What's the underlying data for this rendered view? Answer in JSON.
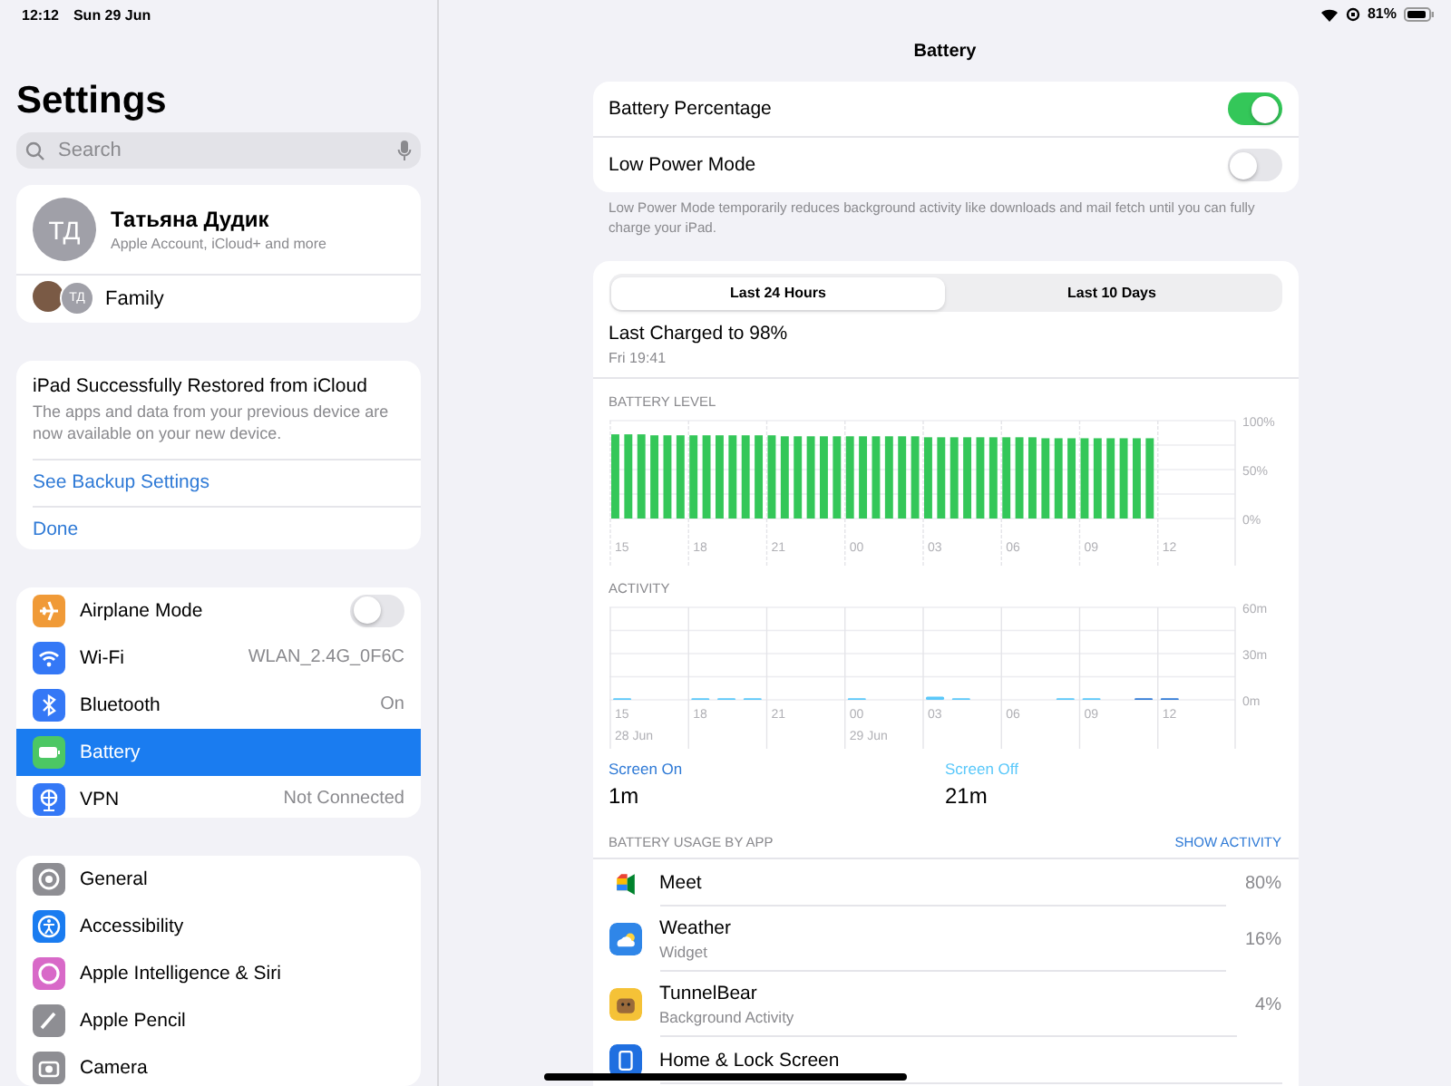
{
  "status_bar": {
    "time": "12:12",
    "date": "Sun 29 Jun",
    "battery": "81%"
  },
  "sidebar": {
    "title": "Settings",
    "search": {
      "placeholder": "Search"
    },
    "profile": {
      "initials": "ТД",
      "name": "Татьяна Дудик",
      "subtitle": "Apple Account, iCloud+ and more",
      "family_initials": "ТД",
      "family_label": "Family"
    },
    "notice": {
      "title": "iPad Successfully Restored from iCloud",
      "text": "The apps and data from your previous device are now available on your new device.",
      "links": [
        "See Backup Settings",
        "Done"
      ]
    },
    "groups": [
      {
        "items": [
          {
            "label": "Airplane Mode",
            "kind": "toggle",
            "on": false,
            "selected": false,
            "color": "#f09a37"
          },
          {
            "label": "Wi-Fi",
            "kind": "value",
            "value": "WLAN_2.4G_0F6C",
            "selected": false,
            "color": "#3478f6"
          },
          {
            "label": "Bluetooth",
            "kind": "value",
            "value": "On",
            "selected": false,
            "color": "#3478f6"
          },
          {
            "label": "Battery",
            "kind": "plain",
            "selected": true,
            "color": "#4cc764"
          },
          {
            "label": "VPN",
            "kind": "value",
            "value": "Not Connected",
            "selected": false,
            "color": "#3478f6"
          }
        ]
      },
      {
        "items": [
          {
            "label": "General",
            "kind": "plain",
            "selected": false,
            "color": "#8e8e93"
          },
          {
            "label": "Accessibility",
            "kind": "plain",
            "selected": false,
            "color": "#1a7cf0"
          },
          {
            "label": "Apple Intelligence & Siri",
            "kind": "plain",
            "selected": false,
            "color": "#d869c8"
          },
          {
            "label": "Apple Pencil",
            "kind": "plain",
            "selected": false,
            "color": "#8e8e93"
          },
          {
            "label": "Camera",
            "kind": "plain",
            "selected": false,
            "color": "#8e8e93"
          }
        ]
      }
    ]
  },
  "detail": {
    "title": "Battery",
    "toggles": [
      {
        "label": "Battery Percentage",
        "on": true
      },
      {
        "label": "Low Power Mode",
        "on": false
      }
    ],
    "footnote": "Low Power Mode temporarily reduces background activity like downloads and mail fetch until you can fully charge your iPad.",
    "tabs": [
      {
        "label": "Last 24 Hours",
        "selected": true
      },
      {
        "label": "Last 10 Days",
        "selected": false
      }
    ],
    "last_charged": {
      "title": "Last Charged to 98%",
      "time": "Fri 19:41"
    },
    "battery_level": {
      "chart_data": {
        "type": "bar",
        "title": "BATTERY LEVEL",
        "ylim": [
          0,
          100
        ],
        "categories": [
          "15",
          null,
          null,
          null,
          null,
          null,
          "18",
          null,
          null,
          null,
          null,
          null,
          "21",
          null,
          null,
          null,
          null,
          null,
          "00",
          null,
          null,
          null,
          null,
          null,
          "03",
          null,
          null,
          null,
          null,
          null,
          "06",
          null,
          null,
          null,
          null,
          null,
          "09",
          null,
          null,
          null,
          null,
          null,
          "12",
          null,
          null,
          null,
          null,
          null
        ],
        "values": [
          86,
          86,
          86,
          85,
          85,
          85,
          85,
          85,
          85,
          85,
          85,
          85,
          85,
          84,
          84,
          84,
          84,
          84,
          84,
          84,
          84,
          84,
          84,
          84,
          83,
          83,
          83,
          83,
          83,
          83,
          83,
          83,
          83,
          82,
          82,
          82,
          82,
          82,
          82,
          82,
          82,
          82,
          null,
          null,
          null,
          null,
          null,
          null
        ],
        "yticks": [
          {
            "value": 0,
            "label": "0%"
          },
          {
            "value": 50,
            "label": "50%"
          },
          {
            "value": 100,
            "label": "100%"
          }
        ]
      }
    },
    "activity": {
      "chart_data": {
        "type": "bar",
        "title": "ACTIVITY",
        "stacked": true,
        "ylim": [
          0,
          60
        ],
        "categories": [
          "15",
          null,
          null,
          "18",
          null,
          null,
          "21",
          null,
          null,
          "00",
          null,
          null,
          "03",
          null,
          null,
          "06",
          null,
          null,
          "09",
          null,
          null,
          "12",
          null,
          null
        ],
        "series": [
          {
            "name": "Screen On",
            "color": "#2f7ad6",
            "values": [
              0,
              0,
              0,
              0,
              0,
              0,
              0,
              0,
              0,
              0,
              0,
              0,
              0,
              0,
              0,
              0,
              0,
              0,
              0,
              0,
              1,
              1,
              0,
              0
            ]
          },
          {
            "name": "Screen Off",
            "color": "#5ac8fa",
            "values": [
              1,
              0,
              0,
              1,
              1,
              1,
              0,
              0,
              0,
              1,
              0,
              0,
              2,
              1,
              0,
              0,
              0,
              1,
              1,
              0,
              0,
              0,
              0,
              0
            ]
          }
        ],
        "yticks": [
          {
            "value": 0,
            "label": "0m"
          },
          {
            "value": 30,
            "label": "30m"
          },
          {
            "value": 60,
            "label": "60m"
          }
        ],
        "annotations": [
          "28 Jun",
          "29 Jun"
        ]
      }
    },
    "totals": [
      {
        "value": "1m"
      },
      {
        "value": "21m"
      }
    ],
    "usage": {
      "header": "BATTERY USAGE BY APP",
      "action": "SHOW ACTIVITY",
      "apps": [
        {
          "name": "Meet",
          "percent": "80%"
        },
        {
          "name": "Weather",
          "subtitle": "Widget",
          "percent": "16%"
        },
        {
          "name": "TunnelBear",
          "subtitle": "Background Activity",
          "percent": "4%"
        },
        {
          "name": "Home & Lock Screen"
        }
      ]
    }
  }
}
